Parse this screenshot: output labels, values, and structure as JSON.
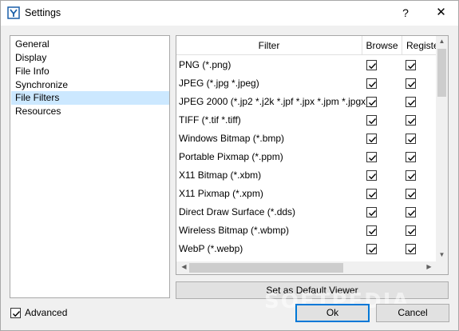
{
  "window": {
    "title": "Settings",
    "help_label": "?",
    "close_label": "✕"
  },
  "nav": {
    "items": [
      {
        "label": "General",
        "selected": false
      },
      {
        "label": "Display",
        "selected": false
      },
      {
        "label": "File Info",
        "selected": false
      },
      {
        "label": "Synchronize",
        "selected": false
      },
      {
        "label": "File Filters",
        "selected": true
      },
      {
        "label": "Resources",
        "selected": false
      }
    ]
  },
  "table": {
    "columns": [
      "Filter",
      "Browse",
      "Registe"
    ],
    "rows": [
      {
        "filter": "PNG (*.png)",
        "browse": true,
        "register": true
      },
      {
        "filter": "JPEG (*.jpg *.jpeg)",
        "browse": true,
        "register": true
      },
      {
        "filter": "JPEG 2000 (*.jp2 *.j2k *.jpf *.jpx *.jpm *.jpgx)",
        "browse": true,
        "register": true
      },
      {
        "filter": "TIFF (*.tif *.tiff)",
        "browse": true,
        "register": true
      },
      {
        "filter": "Windows Bitmap (*.bmp)",
        "browse": true,
        "register": true
      },
      {
        "filter": "Portable Pixmap (*.ppm)",
        "browse": true,
        "register": true
      },
      {
        "filter": "X11 Bitmap (*.xbm)",
        "browse": true,
        "register": true
      },
      {
        "filter": "X11 Pixmap (*.xpm)",
        "browse": true,
        "register": true
      },
      {
        "filter": "Direct Draw Surface (*.dds)",
        "browse": true,
        "register": true
      },
      {
        "filter": "Wireless Bitmap (*.wbmp)",
        "browse": true,
        "register": true
      },
      {
        "filter": "WebP (*.webp)",
        "browse": true,
        "register": true
      }
    ]
  },
  "buttons": {
    "set_default": "Set as Default Viewer",
    "ok": "Ok",
    "cancel": "Cancel"
  },
  "advanced": {
    "label": "Advanced",
    "checked": true
  },
  "watermark": "SOFTPEDIA",
  "colors": {
    "selection": "#cce8ff",
    "accent": "#0078d7"
  }
}
